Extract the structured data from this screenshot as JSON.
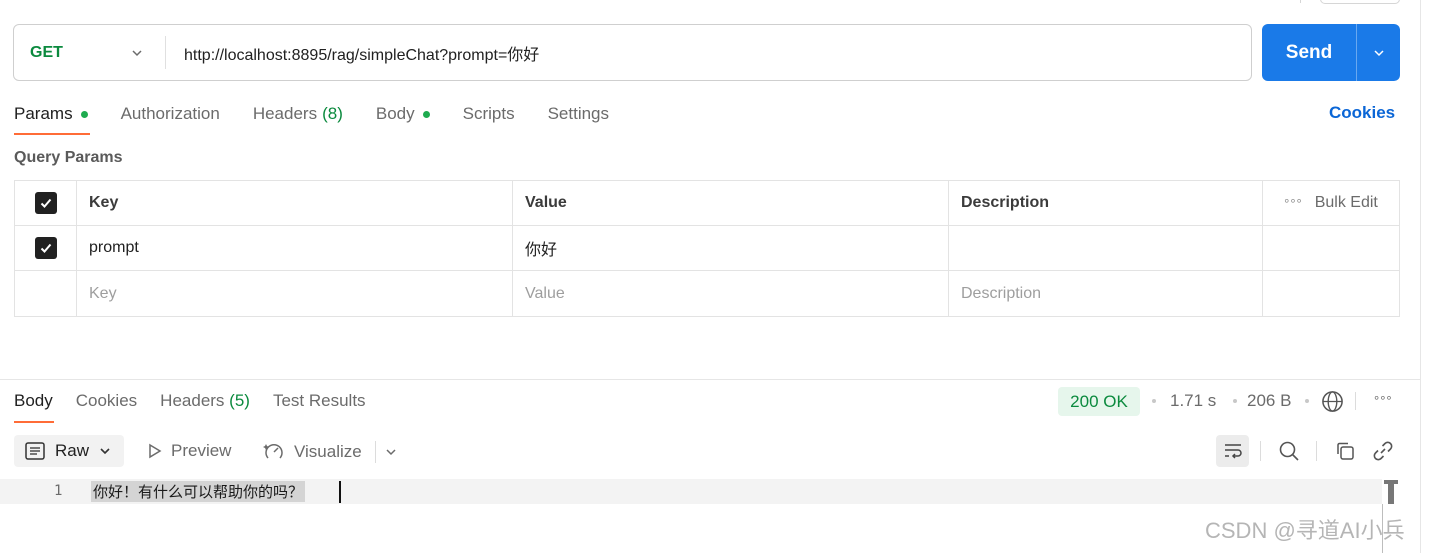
{
  "request": {
    "method": "GET",
    "url": "http://localhost:8895/rag/simpleChat?prompt=你好",
    "send_label": "Send"
  },
  "request_tabs": [
    {
      "label": "Params",
      "has_dot": true,
      "active": true
    },
    {
      "label": "Authorization"
    },
    {
      "label": "Headers",
      "count": "(8)"
    },
    {
      "label": "Body",
      "has_dot": true
    },
    {
      "label": "Scripts"
    },
    {
      "label": "Settings"
    }
  ],
  "cookies_label": "Cookies",
  "query_params": {
    "title": "Query Params",
    "headers": {
      "key": "Key",
      "value": "Value",
      "description": "Description",
      "bulk_edit": "Bulk Edit"
    },
    "rows": [
      {
        "checked": true,
        "key": "prompt",
        "value": "你好",
        "description": ""
      }
    ],
    "placeholders": {
      "key": "Key",
      "value": "Value",
      "description": "Description"
    }
  },
  "response": {
    "tabs": [
      {
        "label": "Body",
        "active": true
      },
      {
        "label": "Cookies"
      },
      {
        "label": "Headers",
        "count": "(5)"
      },
      {
        "label": "Test Results"
      }
    ],
    "status": "200 OK",
    "time": "1.71 s",
    "size": "206 B",
    "format_label": "Raw",
    "preview_label": "Preview",
    "visualize_label": "Visualize",
    "lines": [
      {
        "number": "1",
        "text": "你好！有什么可以帮助你的吗？"
      }
    ]
  },
  "watermark": "CSDN @寻道AI小兵",
  "colors": {
    "accent_orange": "#ff6c37",
    "send_blue": "#1a7ae8",
    "method_green": "#0b8a3e",
    "link_blue": "#0b66d6"
  }
}
